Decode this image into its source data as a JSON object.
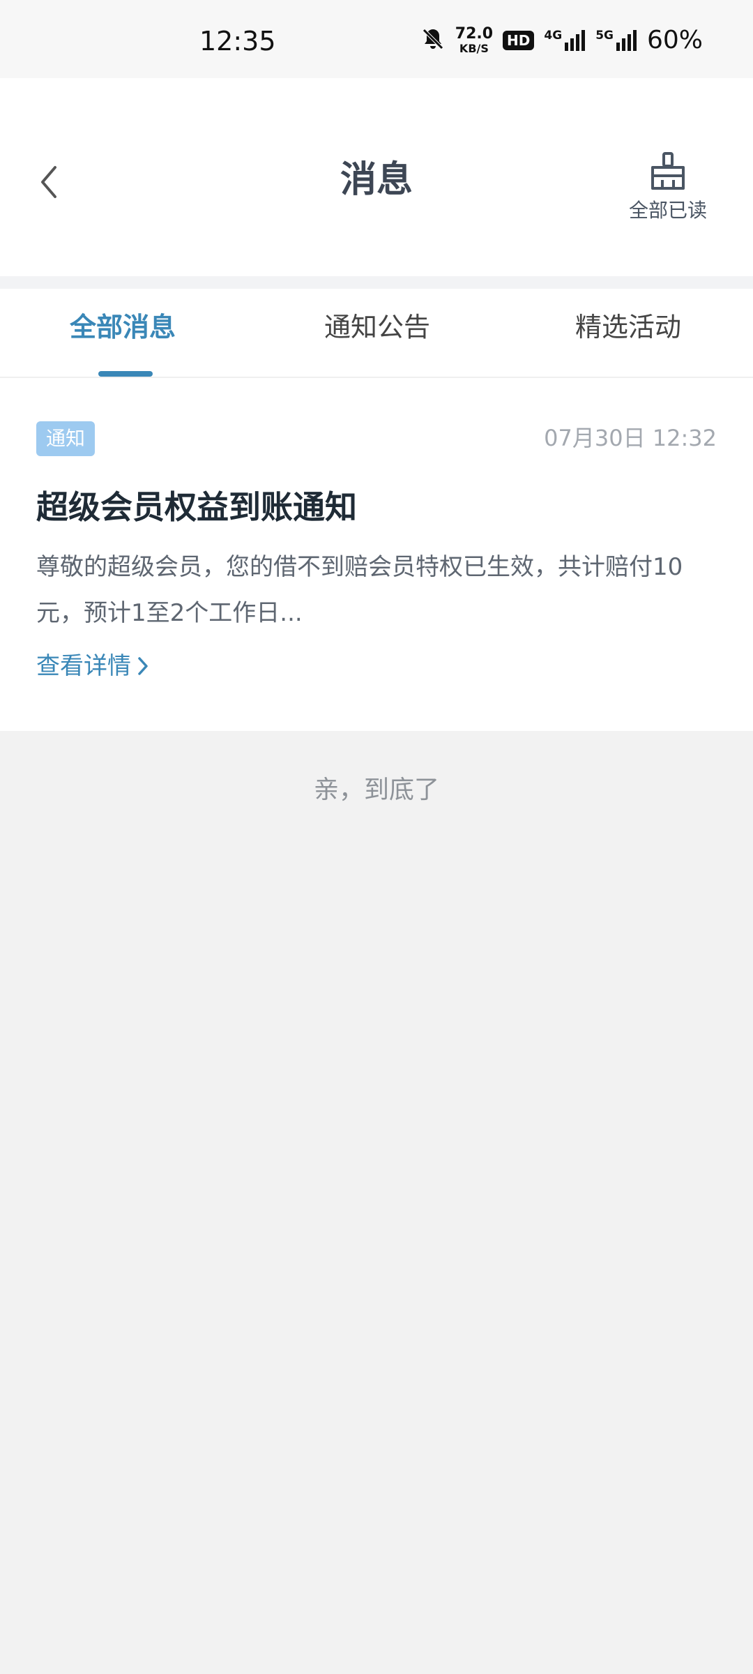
{
  "status_bar": {
    "time": "12:35",
    "speed_value": "72.0",
    "speed_unit": "KB/S",
    "hd_badge": "HD",
    "net_4g": "4G",
    "net_5g": "5G",
    "battery": "60%",
    "icons": [
      "bell-muted-icon",
      "signal-4g-icon",
      "signal-5g-icon"
    ]
  },
  "header": {
    "title": "消息",
    "mark_all_label": "全部已读",
    "icons": [
      "back-chevron-icon",
      "broom-icon"
    ]
  },
  "tabs": [
    {
      "label": "全部消息",
      "active": true
    },
    {
      "label": "通知公告",
      "active": false
    },
    {
      "label": "精选活动",
      "active": false
    }
  ],
  "messages": [
    {
      "tag": "通知",
      "time": "07月30日 12:32",
      "title": "超级会员权益到账通知",
      "body": "尊敬的超级会员，您的借不到赔会员特权已生效，共计赔付10元，预计1至2个工作日...",
      "link_label": "查看详情"
    }
  ],
  "footer": {
    "end_text": "亲，到底了"
  },
  "colors": {
    "accent": "#3a87b7",
    "tag_bg": "#9dcaf0",
    "page_bg": "#f2f2f2"
  }
}
